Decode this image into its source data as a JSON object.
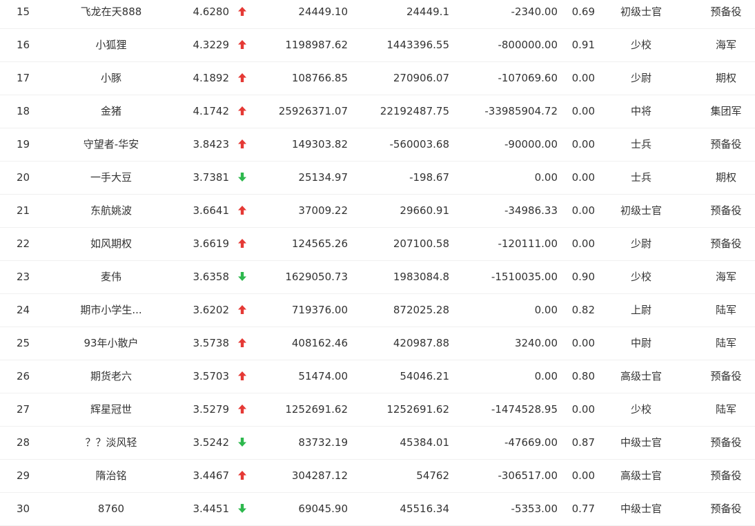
{
  "colors": {
    "up": "#e53935",
    "down": "#2db84d",
    "text": "#333333",
    "divider": "#f0f0f0"
  },
  "rows": [
    {
      "rank": "15",
      "name": "飞龙在天888",
      "score": "4.6280",
      "trend": "up",
      "v1": "24449.10",
      "v2": "24449.1",
      "v3": "-2340.00",
      "ratio": "0.69",
      "rank_title": "初级士官",
      "branch": "预备役"
    },
    {
      "rank": "16",
      "name": "小狐狸",
      "score": "4.3229",
      "trend": "up",
      "v1": "1198987.62",
      "v2": "1443396.55",
      "v3": "-800000.00",
      "ratio": "0.91",
      "rank_title": "少校",
      "branch": "海军"
    },
    {
      "rank": "17",
      "name": "小豚",
      "score": "4.1892",
      "trend": "up",
      "v1": "108766.85",
      "v2": "270906.07",
      "v3": "-107069.60",
      "ratio": "0.00",
      "rank_title": "少尉",
      "branch": "期权"
    },
    {
      "rank": "18",
      "name": "金猪",
      "score": "4.1742",
      "trend": "up",
      "v1": "25926371.07",
      "v2": "22192487.75",
      "v3": "-33985904.72",
      "ratio": "0.00",
      "rank_title": "中将",
      "branch": "集团军"
    },
    {
      "rank": "19",
      "name": "守望者-华安",
      "score": "3.8423",
      "trend": "up",
      "v1": "149303.82",
      "v2": "-560003.68",
      "v3": "-90000.00",
      "ratio": "0.00",
      "rank_title": "士兵",
      "branch": "预备役"
    },
    {
      "rank": "20",
      "name": "一手大豆",
      "score": "3.7381",
      "trend": "down",
      "v1": "25134.97",
      "v2": "-198.67",
      "v3": "0.00",
      "ratio": "0.00",
      "rank_title": "士兵",
      "branch": "期权"
    },
    {
      "rank": "21",
      "name": "东航姚波",
      "score": "3.6641",
      "trend": "up",
      "v1": "37009.22",
      "v2": "29660.91",
      "v3": "-34986.33",
      "ratio": "0.00",
      "rank_title": "初级士官",
      "branch": "预备役"
    },
    {
      "rank": "22",
      "name": "如风期权",
      "score": "3.6619",
      "trend": "up",
      "v1": "124565.26",
      "v2": "207100.58",
      "v3": "-120111.00",
      "ratio": "0.00",
      "rank_title": "少尉",
      "branch": "预备役"
    },
    {
      "rank": "23",
      "name": "麦伟",
      "score": "3.6358",
      "trend": "down",
      "v1": "1629050.73",
      "v2": "1983084.8",
      "v3": "-1510035.00",
      "ratio": "0.90",
      "rank_title": "少校",
      "branch": "海军"
    },
    {
      "rank": "24",
      "name": "期市小学生...",
      "score": "3.6202",
      "trend": "up",
      "v1": "719376.00",
      "v2": "872025.28",
      "v3": "0.00",
      "ratio": "0.82",
      "rank_title": "上尉",
      "branch": "陆军"
    },
    {
      "rank": "25",
      "name": "93年小散户",
      "score": "3.5738",
      "trend": "up",
      "v1": "408162.46",
      "v2": "420987.88",
      "v3": "3240.00",
      "ratio": "0.00",
      "rank_title": "中尉",
      "branch": "陆军"
    },
    {
      "rank": "26",
      "name": "期货老六",
      "score": "3.5703",
      "trend": "up",
      "v1": "51474.00",
      "v2": "54046.21",
      "v3": "0.00",
      "ratio": "0.80",
      "rank_title": "高级士官",
      "branch": "预备役"
    },
    {
      "rank": "27",
      "name": "辉星冠世",
      "score": "3.5279",
      "trend": "up",
      "v1": "1252691.62",
      "v2": "1252691.62",
      "v3": "-1474528.95",
      "ratio": "0.00",
      "rank_title": "少校",
      "branch": "陆军"
    },
    {
      "rank": "28",
      "name": "？？淡风轻",
      "score": "3.5242",
      "trend": "down",
      "v1": "83732.19",
      "v2": "45384.01",
      "v3": "-47669.00",
      "ratio": "0.87",
      "rank_title": "中级士官",
      "branch": "预备役"
    },
    {
      "rank": "29",
      "name": "隋治铭",
      "score": "3.4467",
      "trend": "up",
      "v1": "304287.12",
      "v2": "54762",
      "v3": "-306517.00",
      "ratio": "0.00",
      "rank_title": "高级士官",
      "branch": "预备役"
    },
    {
      "rank": "30",
      "name": "8760",
      "score": "3.4451",
      "trend": "down",
      "v1": "69045.90",
      "v2": "45516.34",
      "v3": "-5353.00",
      "ratio": "0.77",
      "rank_title": "中级士官",
      "branch": "预备役"
    }
  ]
}
